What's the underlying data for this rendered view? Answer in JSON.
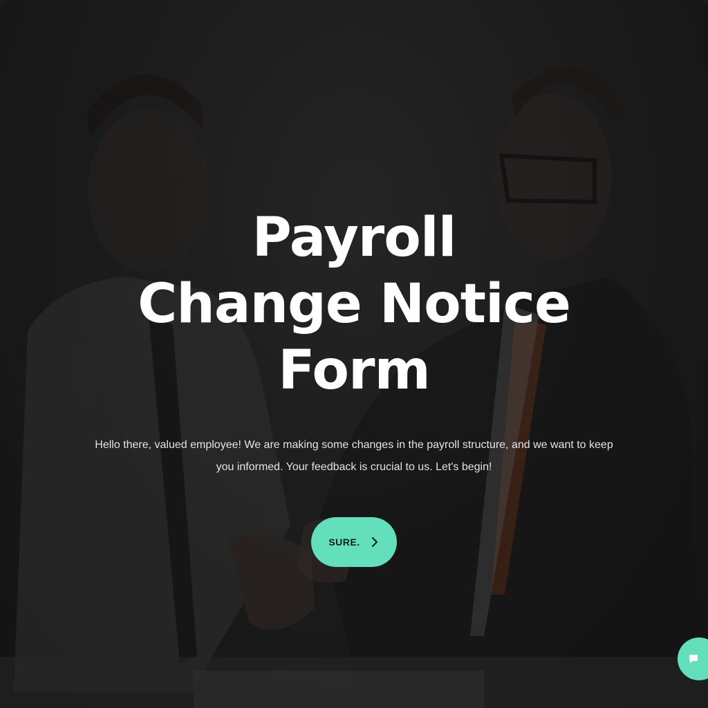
{
  "hero": {
    "title": "Payroll Change Notice Form",
    "subtitle": "Hello there, valued employee! We are making some changes in the payroll structure, and we want to keep you informed. Your feedback is crucial to us. Let's begin!",
    "cta_label": "SURE."
  },
  "icons": {
    "cta_icon": "chevron-right-icon",
    "help_icon": "chat-bubble-icon"
  },
  "colors": {
    "accent": "#63e0bb",
    "title": "#ffffff",
    "text": "#e4e4e4",
    "overlay": "#1e1e1e"
  }
}
